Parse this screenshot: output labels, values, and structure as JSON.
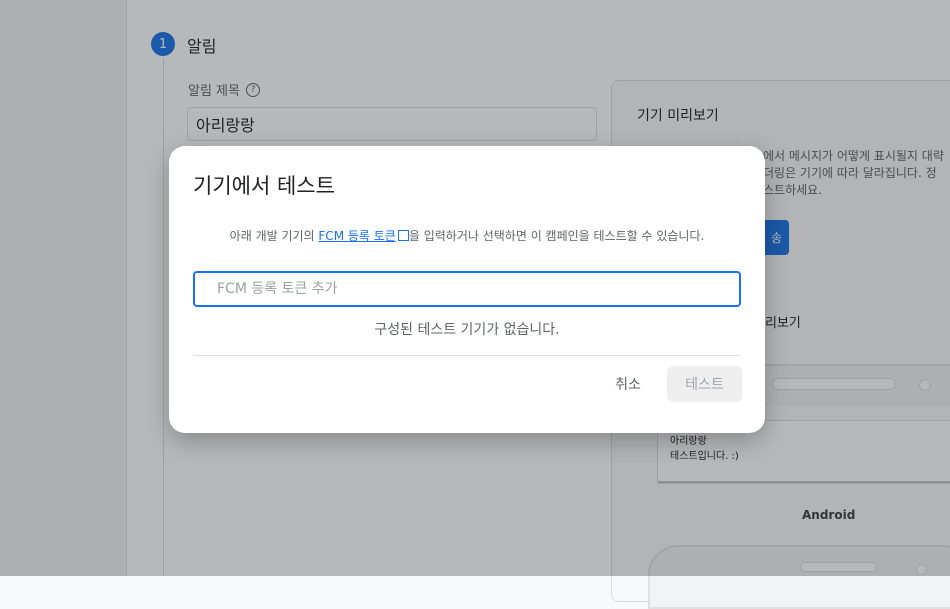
{
  "step": {
    "number": "1",
    "label": "알림"
  },
  "notification_form": {
    "title_label": "알림 제목",
    "help_icon": "help-circle-icon",
    "title_value": "아리랑랑"
  },
  "preview": {
    "title": "기기 미리보기",
    "description": "에서 메시지가 어떻게 표시될지 대략\n더링은 기기에 따라 달라집니다. 정\n스트하세요.",
    "button_fragment": "송",
    "subtitle_fragment": "리보기",
    "notification_title": "아리랑랑",
    "notification_body": "테스트입니다. :)",
    "platform_label": "Android"
  },
  "dialog": {
    "title": "기기에서 테스트",
    "description_before": "아래 개발 기기의 ",
    "description_link": "FCM 등록 토큰",
    "description_after": "을 입력하거나 선택하면 이 캠페인을 테스트할 수 있습니다.",
    "link_icon": "open-in-new-icon",
    "token_input_placeholder": "FCM 등록 토큰 추가",
    "token_input_value": "",
    "empty_message": "구성된 테스트 기기가 없습니다.",
    "cancel_label": "취소",
    "test_label": "테스트"
  },
  "colors": {
    "accent": "#1a73e8",
    "scrim": "rgba(32,33,36,0.32)",
    "disabled_button_bg": "#eeeeee"
  }
}
